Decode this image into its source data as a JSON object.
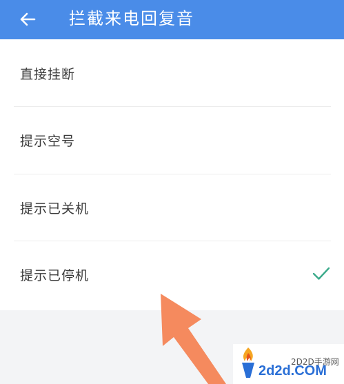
{
  "header": {
    "title": "拦截来电回复音",
    "back_icon": "arrow-left-icon",
    "background_color": "#4a8ce8"
  },
  "options": [
    {
      "label": "直接挂断",
      "selected": false
    },
    {
      "label": "提示空号",
      "selected": false
    },
    {
      "label": "提示已关机",
      "selected": false
    },
    {
      "label": "提示已停机",
      "selected": true
    }
  ],
  "check_icon": "checkmark-icon",
  "check_color": "#3aaa8a",
  "annotation_arrow_color": "#f58a5e",
  "watermark": {
    "site_name": "2D2D手游网",
    "domain": "2d2d.COM",
    "logo_icon": "torch-logo-icon"
  }
}
